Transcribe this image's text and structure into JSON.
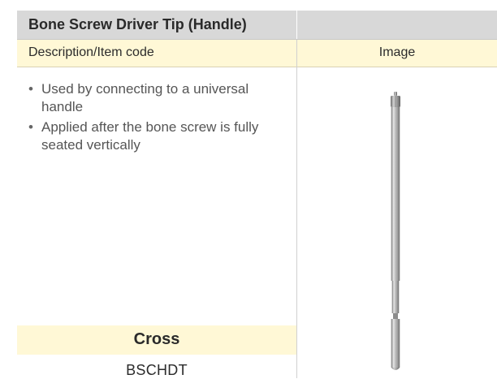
{
  "title": "Bone Screw Driver Tip (Handle)",
  "headers": {
    "description": "Description/Item code",
    "image": "Image"
  },
  "description_items": [
    "Used by connecting to a universal handle",
    "Applied after the bone screw is fully seated vertically"
  ],
  "variant_label": "Cross",
  "item_code": "BSCHDT",
  "colors": {
    "title_background": "#d8d8d8",
    "header_background": "#fff8d6"
  },
  "image_icon": "screw-driver-tip-product-image"
}
